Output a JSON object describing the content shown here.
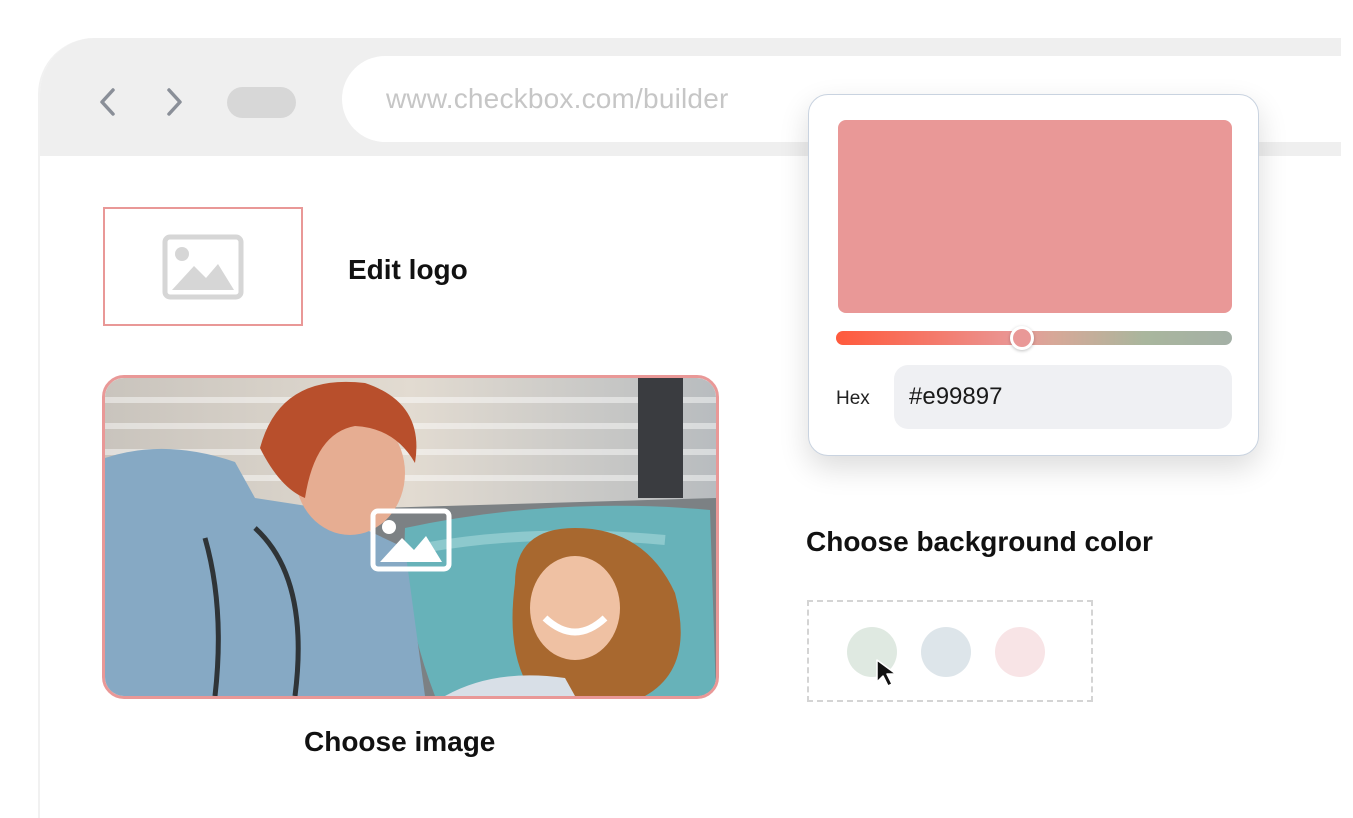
{
  "browser": {
    "url": "www.checkbox.com/builder",
    "back_icon": "chevron-left-icon",
    "forward_icon": "chevron-right-icon"
  },
  "editor": {
    "logo_label": "Edit logo",
    "image_label": "Choose image",
    "image_icon": "image-icon"
  },
  "color_picker": {
    "preview_color": "#e99897",
    "hex_label": "Hex",
    "hex_value": "#e99897",
    "slider_position": 0.47
  },
  "background": {
    "title": "Choose background color",
    "swatches": [
      "#dfe9e1",
      "#dde5ea",
      "#f8e4e6"
    ],
    "pointer_icon": "mouse-pointer-icon"
  }
}
